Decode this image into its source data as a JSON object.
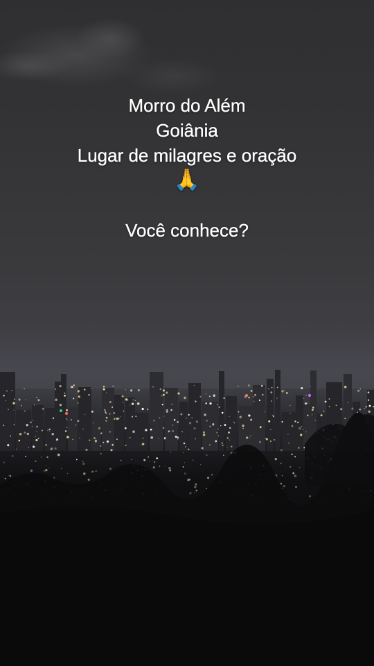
{
  "overlay_text": {
    "line1": "Morro do Além",
    "line2": "Goiânia",
    "line3": "Lugar de milagres e oração",
    "line4": "🙏",
    "line5": "Você conhece?"
  },
  "colors": {
    "sky_top": "#2f2f31",
    "sky_horizon": "#45464c",
    "city_light_warm": "#f3d9a0",
    "city_light_white": "#ffffff",
    "foreground": "#0b0b0c",
    "text": "#ffffff"
  }
}
